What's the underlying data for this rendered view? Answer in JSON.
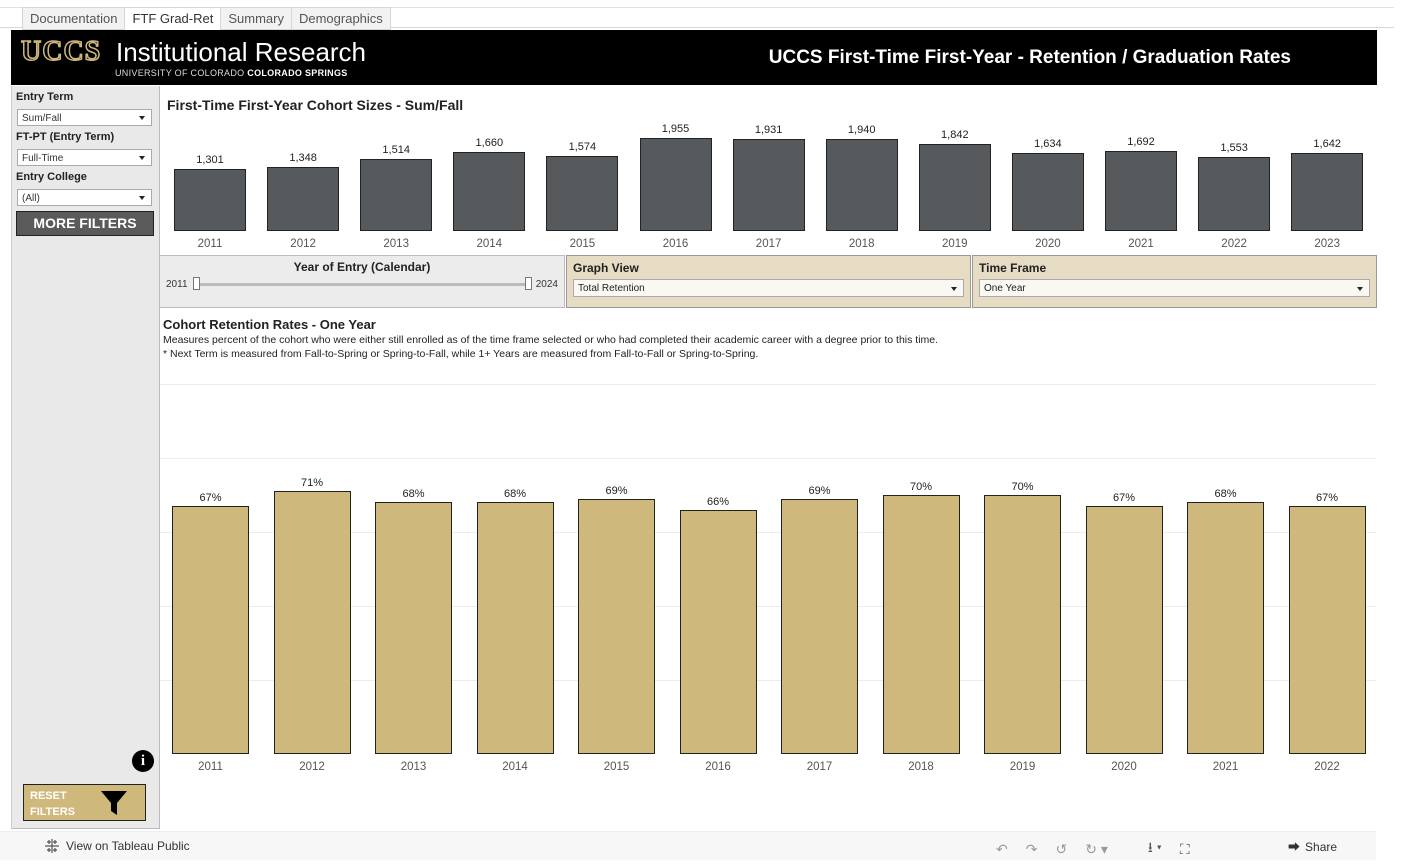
{
  "tabs": [
    "Documentation",
    "FTF Grad-Ret",
    "Summary",
    "Demographics"
  ],
  "header": {
    "logo": "UCCS",
    "logo_text": "Institutional Research",
    "logo_sub_a": "UNIVERSITY OF COLORADO ",
    "logo_sub_b": "COLORADO SPRINGS",
    "title": "UCCS First-Time First-Year - Retention / Graduation Rates"
  },
  "sidebar": {
    "entry_term_label": "Entry Term",
    "entry_term_value": "Sum/Fall",
    "ftpt_label": "FT-PT (Entry Term)",
    "ftpt_value": "Full-Time",
    "college_label": "Entry College",
    "college_value": "(All)",
    "more_filters": "MORE FILTERS",
    "info": "i",
    "reset": "RESET FILTERS"
  },
  "controls": {
    "slider_title": "Year of Entry (Calendar)",
    "slider_min": "2011",
    "slider_max": "2024",
    "graph_view_label": "Graph View",
    "graph_view_value": "Total Retention",
    "time_frame_label": "Time Frame",
    "time_frame_value": "One Year"
  },
  "retention": {
    "desc1": "Measures percent of the cohort who were either still enrolled as of the time frame selected or who had completed their academic career with a degree prior to this time.",
    "desc2": "* Next Term is measured from Fall-to-Spring or Spring-to-Fall, while  1+ Years are measured from Fall-to-Fall or Spring-to-Spring."
  },
  "footer": {
    "view_on": "View on Tableau Public",
    "share": "Share"
  },
  "colors": {
    "bar_dark": "#565a5c",
    "bar_gold": "#cfb87c",
    "header_bg": "#000000"
  },
  "chart_data": [
    {
      "type": "bar",
      "title": "First-Time First-Year Cohort Sizes - Sum/Fall",
      "categories": [
        "2011",
        "2012",
        "2013",
        "2014",
        "2015",
        "2016",
        "2017",
        "2018",
        "2019",
        "2020",
        "2021",
        "2022",
        "2023"
      ],
      "values": [
        1301,
        1348,
        1514,
        1660,
        1574,
        1955,
        1931,
        1940,
        1842,
        1634,
        1692,
        1553,
        1642
      ],
      "labels": [
        "1,301",
        "1,348",
        "1,514",
        "1,660",
        "1,574",
        "1,955",
        "1,931",
        "1,940",
        "1,842",
        "1,634",
        "1,692",
        "1,553",
        "1,642"
      ]
    },
    {
      "type": "bar",
      "title": "Cohort Retention Rates - One Year",
      "categories": [
        "2011",
        "2012",
        "2013",
        "2014",
        "2015",
        "2016",
        "2017",
        "2018",
        "2019",
        "2020",
        "2021",
        "2022"
      ],
      "values": [
        67,
        71,
        68,
        68,
        69,
        66,
        69,
        70,
        70,
        67,
        68,
        67
      ],
      "labels": [
        "67%",
        "71%",
        "68%",
        "68%",
        "69%",
        "66%",
        "69%",
        "70%",
        "70%",
        "67%",
        "68%",
        "67%"
      ],
      "ylim": [
        0,
        100
      ]
    }
  ]
}
